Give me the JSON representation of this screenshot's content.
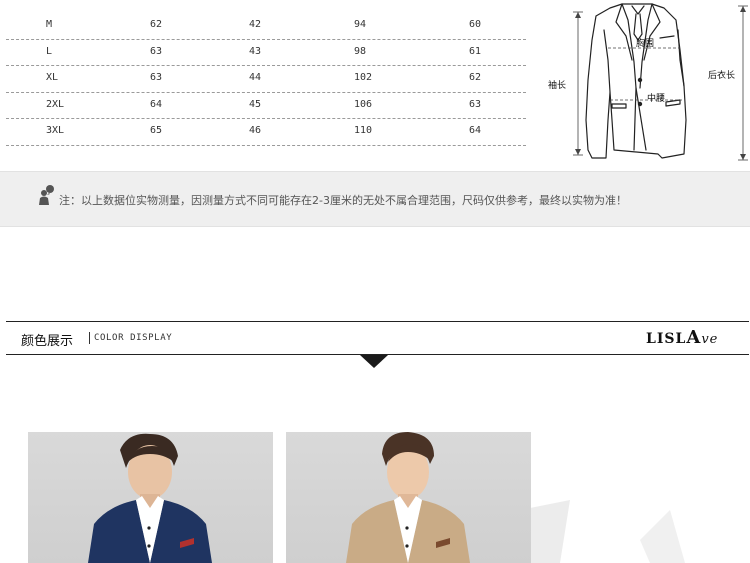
{
  "size_table": {
    "rows": [
      [
        "M",
        "62",
        "42",
        "94",
        "60"
      ],
      [
        "L",
        "63",
        "43",
        "98",
        "61"
      ],
      [
        "XL",
        "63",
        "44",
        "102",
        "62"
      ],
      [
        "2XL",
        "64",
        "45",
        "106",
        "63"
      ],
      [
        "3XL",
        "65",
        "46",
        "110",
        "64"
      ]
    ]
  },
  "diagram": {
    "chest_label": "胸围",
    "sleeve_label": "袖长",
    "waist_label": "中腰",
    "back_length_label": "后衣长"
  },
  "note": {
    "text": "注：以上数据位实物测量，因测量方式不同可能存在2-3厘米的无处不属合理范围，尺码仅供参考，最终以实物为准！",
    "icon": "speech-person-icon"
  },
  "section": {
    "title": "颜色展示",
    "subtitle": "COLOR DISPLAY",
    "brand_prefix": "LISL",
    "brand_a": "A",
    "brand_suffix": "ve"
  },
  "colors": {
    "navy": "#1f3461",
    "tan": "#c9ab86",
    "note_bg": "#efefef",
    "icon": "#555555"
  }
}
